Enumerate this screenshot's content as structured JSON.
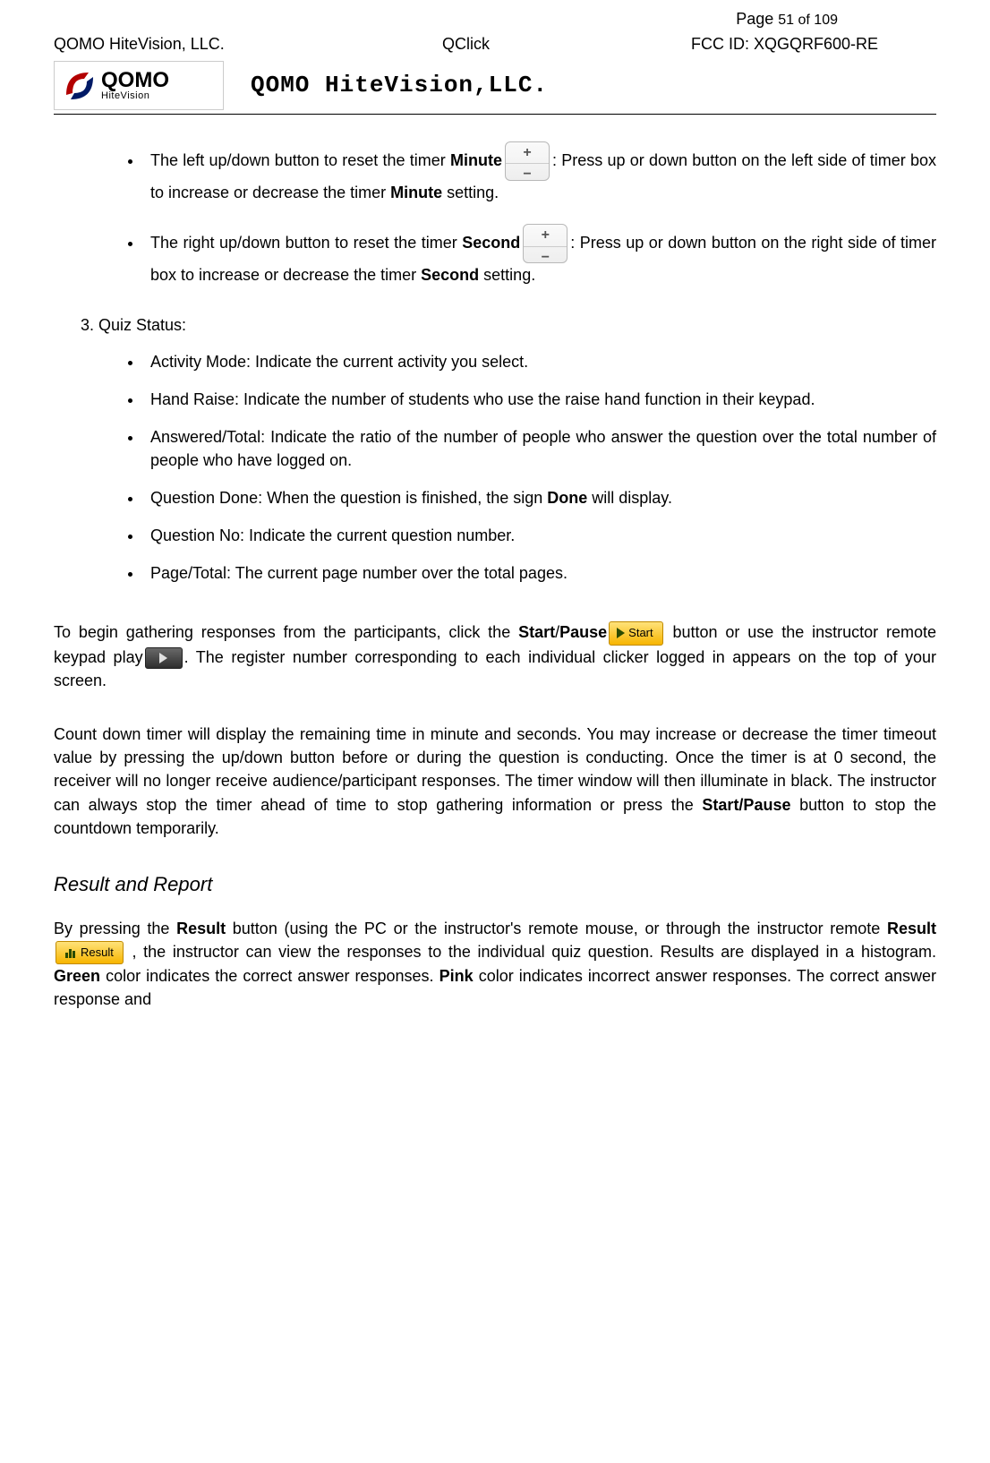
{
  "header": {
    "page_label": "Page ",
    "page_value": "51 of 109",
    "company_left": "QOMO HiteVision, LLC.",
    "product": "QClick",
    "fcc": "FCC ID: XQGQRF600-RE",
    "company_title": "QOMO HiteVision,LLC.",
    "logo_big": "QOMO",
    "logo_small": "HiteVision"
  },
  "timer_bullets": {
    "minute_pre": "The left up/down button to reset the timer ",
    "minute_bold1": "Minute",
    "minute_mid": ": Press up or down button on the left side of timer box to increase or decrease the timer ",
    "minute_bold2": "Minute",
    "minute_post": " setting.",
    "second_pre": "The right up/down button to reset the timer ",
    "second_bold1": "Second",
    "second_mid": ": Press up or down button on the right side of timer box to increase or decrease the timer ",
    "second_bold2": "Second",
    "second_post": " setting."
  },
  "quiz_status": {
    "heading": "3.  Quiz Status:",
    "items": [
      "Activity Mode: Indicate the current activity you select.",
      "Hand Raise: Indicate the number of students who use the raise hand function in their keypad.",
      "Answered/Total: Indicate the ratio of the number of people who answer the question over the total number of people who have logged on.",
      "",
      "Question No: Indicate the current question number.",
      "Page/Total: The current page number over the total pages."
    ],
    "item4_pre": "Question Done: When the question is finished, the sign ",
    "item4_bold": "Done",
    "item4_post": " will display."
  },
  "para1": {
    "p1": "To begin gathering responses from the participants, click the ",
    "b1": "Start",
    "slash": "/",
    "b2": "Pause",
    "p2": " button or use the instructor remote keypad play",
    "p3": ". The register number corresponding to each individual clicker logged in appears on the top of your screen."
  },
  "para2": {
    "t1": "Count down timer will display the remaining time in minute and seconds. You may increase or decrease the timer timeout value by pressing the up/down button before or during the question is conducting. Once the timer is at 0 second, the receiver will no longer receive audience/participant responses. The timer window will then illuminate in black. The  instructor  can always stop the timer  ahead  of  time  to  stop  gathering information or press the ",
    "b1": "Start/Pause",
    "t2": " button to stop the countdown   temporarily."
  },
  "result": {
    "heading": "Result and Report",
    "p1": "By pressing the ",
    "b1": "Result",
    "p2": " button (using the PC or the instructor's remote mouse, or through the instructor remote ",
    "b2": "Result",
    "p3": " , the instructor can view the responses to the individual quiz question. Results are displayed in a histogram.  ",
    "b3": "Green",
    "p4": " color indicates the correct answer responses. ",
    "b4": "Pink",
    "p5": " color indicates incorrect answer responses. The correct answer response and"
  },
  "buttons": {
    "start_label": "Start",
    "result_label": "Result"
  }
}
